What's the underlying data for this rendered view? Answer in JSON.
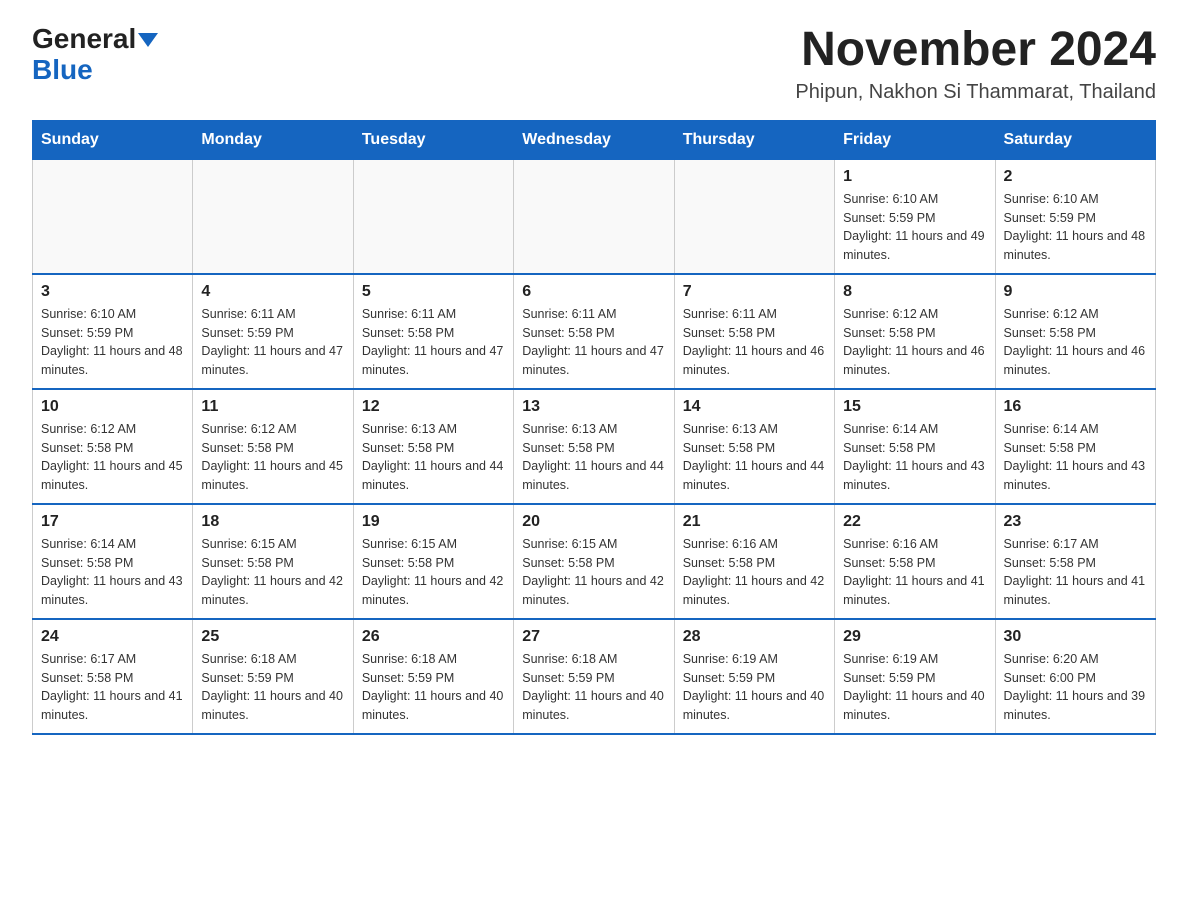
{
  "logo": {
    "general": "General",
    "blue": "Blue"
  },
  "title": "November 2024",
  "subtitle": "Phipun, Nakhon Si Thammarat, Thailand",
  "days_of_week": [
    "Sunday",
    "Monday",
    "Tuesday",
    "Wednesday",
    "Thursday",
    "Friday",
    "Saturday"
  ],
  "weeks": [
    [
      {
        "day": "",
        "info": ""
      },
      {
        "day": "",
        "info": ""
      },
      {
        "day": "",
        "info": ""
      },
      {
        "day": "",
        "info": ""
      },
      {
        "day": "",
        "info": ""
      },
      {
        "day": "1",
        "info": "Sunrise: 6:10 AM\nSunset: 5:59 PM\nDaylight: 11 hours and 49 minutes."
      },
      {
        "day": "2",
        "info": "Sunrise: 6:10 AM\nSunset: 5:59 PM\nDaylight: 11 hours and 48 minutes."
      }
    ],
    [
      {
        "day": "3",
        "info": "Sunrise: 6:10 AM\nSunset: 5:59 PM\nDaylight: 11 hours and 48 minutes."
      },
      {
        "day": "4",
        "info": "Sunrise: 6:11 AM\nSunset: 5:59 PM\nDaylight: 11 hours and 47 minutes."
      },
      {
        "day": "5",
        "info": "Sunrise: 6:11 AM\nSunset: 5:58 PM\nDaylight: 11 hours and 47 minutes."
      },
      {
        "day": "6",
        "info": "Sunrise: 6:11 AM\nSunset: 5:58 PM\nDaylight: 11 hours and 47 minutes."
      },
      {
        "day": "7",
        "info": "Sunrise: 6:11 AM\nSunset: 5:58 PM\nDaylight: 11 hours and 46 minutes."
      },
      {
        "day": "8",
        "info": "Sunrise: 6:12 AM\nSunset: 5:58 PM\nDaylight: 11 hours and 46 minutes."
      },
      {
        "day": "9",
        "info": "Sunrise: 6:12 AM\nSunset: 5:58 PM\nDaylight: 11 hours and 46 minutes."
      }
    ],
    [
      {
        "day": "10",
        "info": "Sunrise: 6:12 AM\nSunset: 5:58 PM\nDaylight: 11 hours and 45 minutes."
      },
      {
        "day": "11",
        "info": "Sunrise: 6:12 AM\nSunset: 5:58 PM\nDaylight: 11 hours and 45 minutes."
      },
      {
        "day": "12",
        "info": "Sunrise: 6:13 AM\nSunset: 5:58 PM\nDaylight: 11 hours and 44 minutes."
      },
      {
        "day": "13",
        "info": "Sunrise: 6:13 AM\nSunset: 5:58 PM\nDaylight: 11 hours and 44 minutes."
      },
      {
        "day": "14",
        "info": "Sunrise: 6:13 AM\nSunset: 5:58 PM\nDaylight: 11 hours and 44 minutes."
      },
      {
        "day": "15",
        "info": "Sunrise: 6:14 AM\nSunset: 5:58 PM\nDaylight: 11 hours and 43 minutes."
      },
      {
        "day": "16",
        "info": "Sunrise: 6:14 AM\nSunset: 5:58 PM\nDaylight: 11 hours and 43 minutes."
      }
    ],
    [
      {
        "day": "17",
        "info": "Sunrise: 6:14 AM\nSunset: 5:58 PM\nDaylight: 11 hours and 43 minutes."
      },
      {
        "day": "18",
        "info": "Sunrise: 6:15 AM\nSunset: 5:58 PM\nDaylight: 11 hours and 42 minutes."
      },
      {
        "day": "19",
        "info": "Sunrise: 6:15 AM\nSunset: 5:58 PM\nDaylight: 11 hours and 42 minutes."
      },
      {
        "day": "20",
        "info": "Sunrise: 6:15 AM\nSunset: 5:58 PM\nDaylight: 11 hours and 42 minutes."
      },
      {
        "day": "21",
        "info": "Sunrise: 6:16 AM\nSunset: 5:58 PM\nDaylight: 11 hours and 42 minutes."
      },
      {
        "day": "22",
        "info": "Sunrise: 6:16 AM\nSunset: 5:58 PM\nDaylight: 11 hours and 41 minutes."
      },
      {
        "day": "23",
        "info": "Sunrise: 6:17 AM\nSunset: 5:58 PM\nDaylight: 11 hours and 41 minutes."
      }
    ],
    [
      {
        "day": "24",
        "info": "Sunrise: 6:17 AM\nSunset: 5:58 PM\nDaylight: 11 hours and 41 minutes."
      },
      {
        "day": "25",
        "info": "Sunrise: 6:18 AM\nSunset: 5:59 PM\nDaylight: 11 hours and 40 minutes."
      },
      {
        "day": "26",
        "info": "Sunrise: 6:18 AM\nSunset: 5:59 PM\nDaylight: 11 hours and 40 minutes."
      },
      {
        "day": "27",
        "info": "Sunrise: 6:18 AM\nSunset: 5:59 PM\nDaylight: 11 hours and 40 minutes."
      },
      {
        "day": "28",
        "info": "Sunrise: 6:19 AM\nSunset: 5:59 PM\nDaylight: 11 hours and 40 minutes."
      },
      {
        "day": "29",
        "info": "Sunrise: 6:19 AM\nSunset: 5:59 PM\nDaylight: 11 hours and 40 minutes."
      },
      {
        "day": "30",
        "info": "Sunrise: 6:20 AM\nSunset: 6:00 PM\nDaylight: 11 hours and 39 minutes."
      }
    ]
  ]
}
